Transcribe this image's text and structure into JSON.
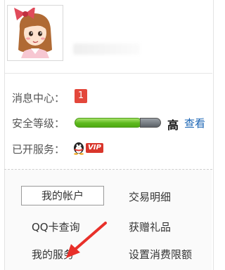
{
  "profile": {
    "avatar_icon": "cartoon-girl-avatar"
  },
  "info": {
    "message_label": "消息中心：",
    "message_count": "1",
    "security_label": "安全等级：",
    "security_level": "高",
    "security_progress": 0.8,
    "view_link": "查看",
    "services_label": "已开服务：",
    "vip_badge": "VIP"
  },
  "menu": {
    "my_account": "我的帐户",
    "transactions": "交易明细",
    "qq_card": "QQ卡查询",
    "gifts": "获赠礼品",
    "my_services": "我的服务",
    "spending_limit": "设置消费限额"
  },
  "colors": {
    "badge_red": "#e3473b",
    "link_blue": "#1a64b4",
    "progress_green": "#5cb81d",
    "arrow_red": "#e8302a"
  }
}
